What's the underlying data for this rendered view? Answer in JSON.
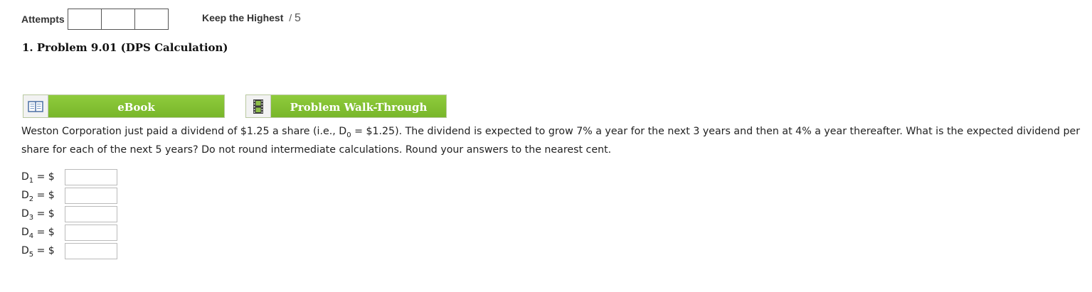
{
  "header": {
    "attempts_label": "Attempts",
    "attempt_box_count": 3,
    "keep_highest_label": "Keep the Highest",
    "score_separator": "/",
    "max_score": "5"
  },
  "problem": {
    "title": "1.  Problem 9.01 (DPS Calculation)"
  },
  "tools": {
    "ebook_label": "eBook",
    "ebook_icon": "book-icon",
    "walkthrough_label": "Problem Walk-Through",
    "walkthrough_icon": "film-strip-icon"
  },
  "question": {
    "part1": "Weston Corporation just paid a dividend of $1.25 a share (i.e., D",
    "sub": "0",
    "part2": " = $1.25). The dividend is expected to grow 7% a year for the next 3 years and then at 4% a year thereafter. What is the expected dividend per share for each of the next 5 years? Do not round intermediate calculations. Round your answers to the nearest cent."
  },
  "answers": [
    {
      "letter": "D",
      "sub": "1",
      "suffix": " = $",
      "value": ""
    },
    {
      "letter": "D",
      "sub": "2",
      "suffix": " = $",
      "value": ""
    },
    {
      "letter": "D",
      "sub": "3",
      "suffix": " = $",
      "value": ""
    },
    {
      "letter": "D",
      "sub": "4",
      "suffix": " = $",
      "value": ""
    },
    {
      "letter": "D",
      "sub": "5",
      "suffix": " = $",
      "value": ""
    }
  ]
}
